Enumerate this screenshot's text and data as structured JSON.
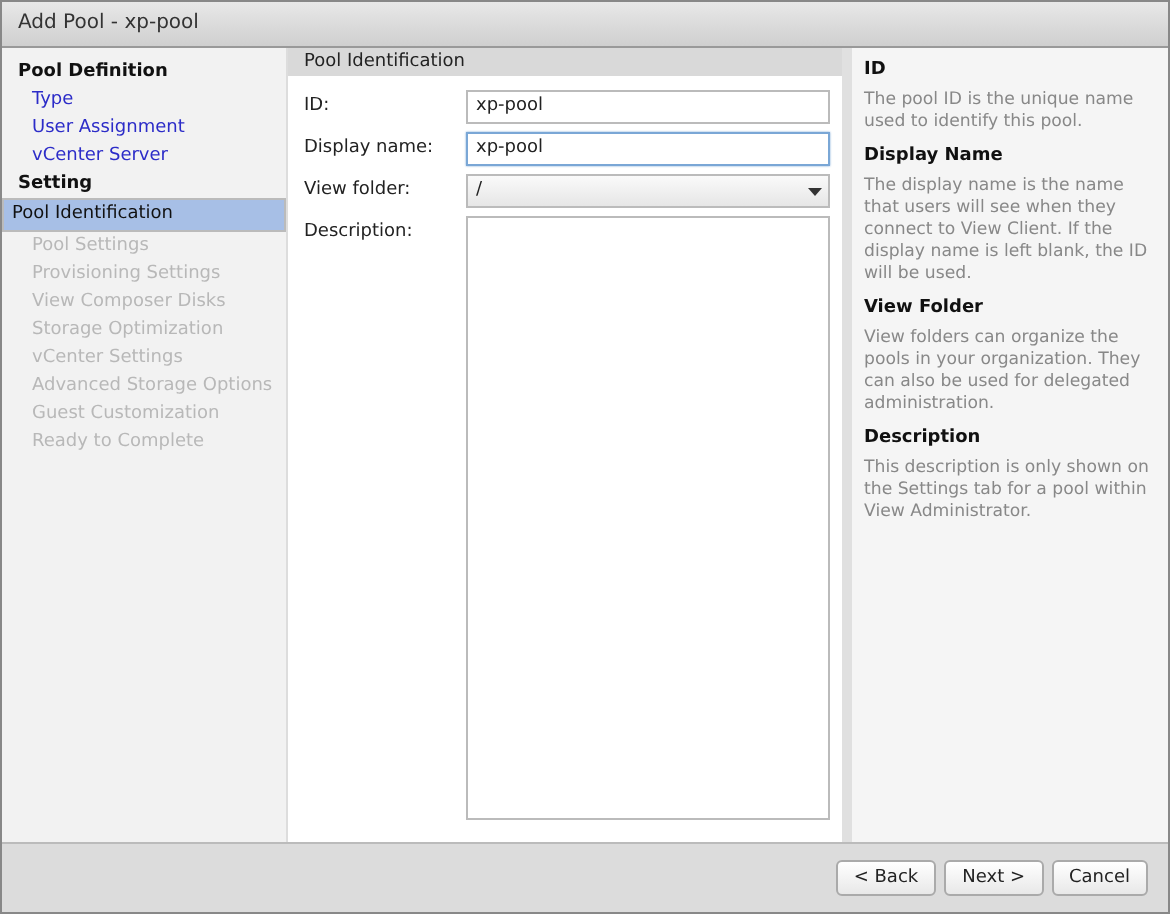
{
  "window": {
    "title": "Add Pool - xp-pool"
  },
  "sidebar": {
    "sections": [
      {
        "heading": "Pool Definition",
        "steps": [
          {
            "label": "Type",
            "selected": false,
            "disabled": false
          },
          {
            "label": "User Assignment",
            "selected": false,
            "disabled": false
          },
          {
            "label": "vCenter Server",
            "selected": false,
            "disabled": false
          }
        ]
      },
      {
        "heading": "Setting",
        "steps": [
          {
            "label": "Pool Identification",
            "selected": true,
            "disabled": false
          },
          {
            "label": "Pool Settings",
            "selected": false,
            "disabled": true
          },
          {
            "label": "Provisioning Settings",
            "selected": false,
            "disabled": true
          },
          {
            "label": "View Composer Disks",
            "selected": false,
            "disabled": true
          },
          {
            "label": "Storage Optimization",
            "selected": false,
            "disabled": true
          },
          {
            "label": "vCenter Settings",
            "selected": false,
            "disabled": true
          },
          {
            "label": "Advanced Storage Options",
            "selected": false,
            "disabled": true
          },
          {
            "label": "Guest Customization",
            "selected": false,
            "disabled": true
          },
          {
            "label": "Ready to Complete",
            "selected": false,
            "disabled": true
          }
        ]
      }
    ]
  },
  "form": {
    "title": "Pool Identification",
    "fields": [
      {
        "kind": "input",
        "label": "ID:",
        "value": "xp-pool",
        "focused": false
      },
      {
        "kind": "input",
        "label": "Display name:",
        "value": "xp-pool",
        "focused": true
      },
      {
        "kind": "select",
        "label": "View folder:",
        "value": "/",
        "focused": false
      },
      {
        "kind": "textarea",
        "label": "Description:",
        "focused": false
      }
    ]
  },
  "help": [
    {
      "heading": "ID",
      "text": "The pool ID is the unique name used to identify this pool."
    },
    {
      "heading": "Display Name",
      "text": "The display name is the name that users will see when they connect to View Client. If the display name is left blank, the ID will be used."
    },
    {
      "heading": "View Folder",
      "text": "View folders can organize the pools in your organization. They can also be used for delegated administration."
    },
    {
      "heading": "Description",
      "text": "This description is only shown on the Settings tab for a pool within View Administrator."
    }
  ],
  "buttons": [
    {
      "label": "< Back",
      "disabled": false
    },
    {
      "label": "Next >",
      "disabled": false
    },
    {
      "label": "Cancel",
      "disabled": false
    }
  ]
}
